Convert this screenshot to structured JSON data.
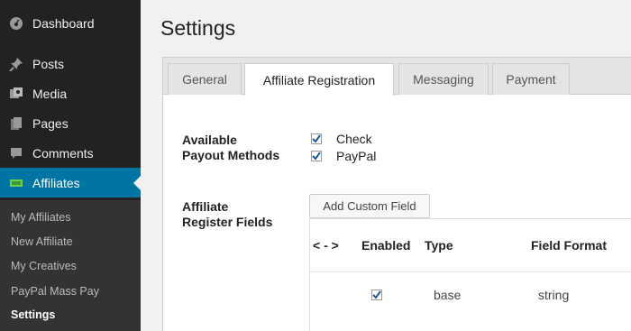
{
  "sidebar": {
    "items": [
      {
        "label": "Dashboard",
        "icon": "dashboard-icon"
      },
      {
        "label": "Posts",
        "icon": "pin-icon"
      },
      {
        "label": "Media",
        "icon": "media-icon"
      },
      {
        "label": "Pages",
        "icon": "pages-icon"
      },
      {
        "label": "Comments",
        "icon": "comment-icon"
      },
      {
        "label": "Affiliates",
        "icon": "money-icon",
        "active": true
      }
    ],
    "submenu": [
      "My Affiliates",
      "New Affiliate",
      "My Creatives",
      "PayPal Mass Pay",
      "Settings"
    ],
    "current_submenu": "Settings"
  },
  "page": {
    "title": "Settings"
  },
  "tabs": [
    {
      "label": "General"
    },
    {
      "label": "Affiliate Registration",
      "active": true
    },
    {
      "label": "Messaging"
    },
    {
      "label": "Payment"
    }
  ],
  "payout": {
    "label_line1": "Available",
    "label_line2": "Payout Methods",
    "options": [
      {
        "label": "Check",
        "checked": true
      },
      {
        "label": "PayPal",
        "checked": true
      }
    ]
  },
  "register_fields": {
    "label_line1": "Affiliate",
    "label_line2": "Register Fields",
    "add_button": "Add Custom Field",
    "columns": [
      "< - >",
      "Enabled",
      "Type",
      "Field Format"
    ],
    "rows": [
      {
        "enabled": true,
        "type": "base",
        "format": "string"
      }
    ]
  },
  "colors": {
    "sidebar": "#222222",
    "active": "#0074a2",
    "submenu": "#333333"
  }
}
